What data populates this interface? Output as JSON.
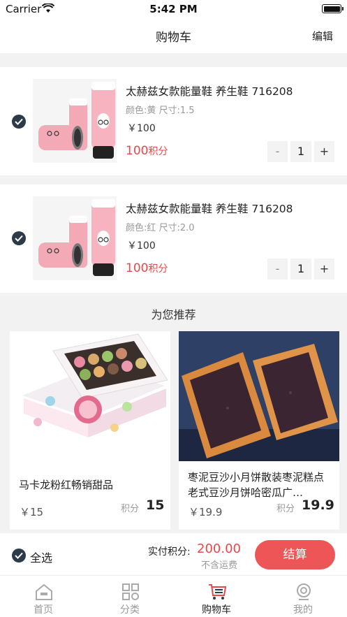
{
  "status": {
    "carrier": "Carrier",
    "time": "5:42 PM"
  },
  "nav": {
    "title": "购物车",
    "edit": "编辑"
  },
  "cart": {
    "items": [
      {
        "title": "太赫兹女款能量鞋 养生鞋 716208",
        "spec": "颜色:黄 尺寸:1.5",
        "price": "￥100",
        "points": "100",
        "points_unit": "积分",
        "qty": "1",
        "minus": "-",
        "plus": "+"
      },
      {
        "title": "太赫兹女款能量鞋 养生鞋 716208",
        "spec": "颜色:红 尺寸:2.0",
        "price": "￥100",
        "points": "100",
        "points_unit": "积分",
        "qty": "1",
        "minus": "-",
        "plus": "+"
      }
    ]
  },
  "recommend": {
    "title": "为您推荐",
    "items": [
      {
        "name": "马卡龙粉红畅销甜品",
        "price": "￥15",
        "points_label": "积分",
        "points": "15"
      },
      {
        "name": "枣泥豆沙小月饼散装枣泥糕点老式豆沙月饼哈密瓜广…",
        "price": "￥19.9",
        "points_label": "积分",
        "points": "19.9"
      }
    ]
  },
  "footer": {
    "select_all": "全选",
    "total_label": "实付积分:",
    "total_value": "200.00",
    "shipping": "不含运费",
    "checkout": "结算"
  },
  "tabs": [
    {
      "label": "首页",
      "icon": "home-icon"
    },
    {
      "label": "分类",
      "icon": "category-icon"
    },
    {
      "label": "购物车",
      "icon": "cart-icon"
    },
    {
      "label": "我的",
      "icon": "profile-icon"
    }
  ],
  "colors": {
    "accent": "#e8474b",
    "checkout": "#ee5557",
    "check": "#2d3a4a"
  }
}
